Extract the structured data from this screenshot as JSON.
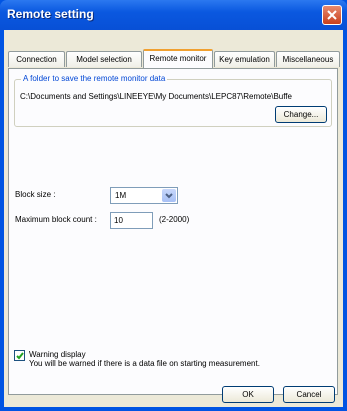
{
  "window": {
    "title": "Remote setting"
  },
  "tabs": [
    {
      "label": "Connection"
    },
    {
      "label": "Model selection"
    },
    {
      "label": "Remote monitor"
    },
    {
      "label": "Key emulation"
    },
    {
      "label": "Miscellaneous"
    }
  ],
  "folder_group": {
    "legend": "A folder to save the remote monitor data",
    "path": "C:\\Documents and Settings\\LINEEYE\\My Documents\\LEPC87\\Remote\\Buffe",
    "change_label": "Change..."
  },
  "block_size": {
    "label": "Block size :",
    "value": "1M"
  },
  "max_block_count": {
    "label": "Maximum block count :",
    "value": "10",
    "range": "(2-2000)"
  },
  "warning": {
    "checked": true,
    "label": "Warning display",
    "description": "You will be warned if there is a data file on starting measurement."
  },
  "buttons": {
    "ok": "OK",
    "cancel": "Cancel"
  }
}
